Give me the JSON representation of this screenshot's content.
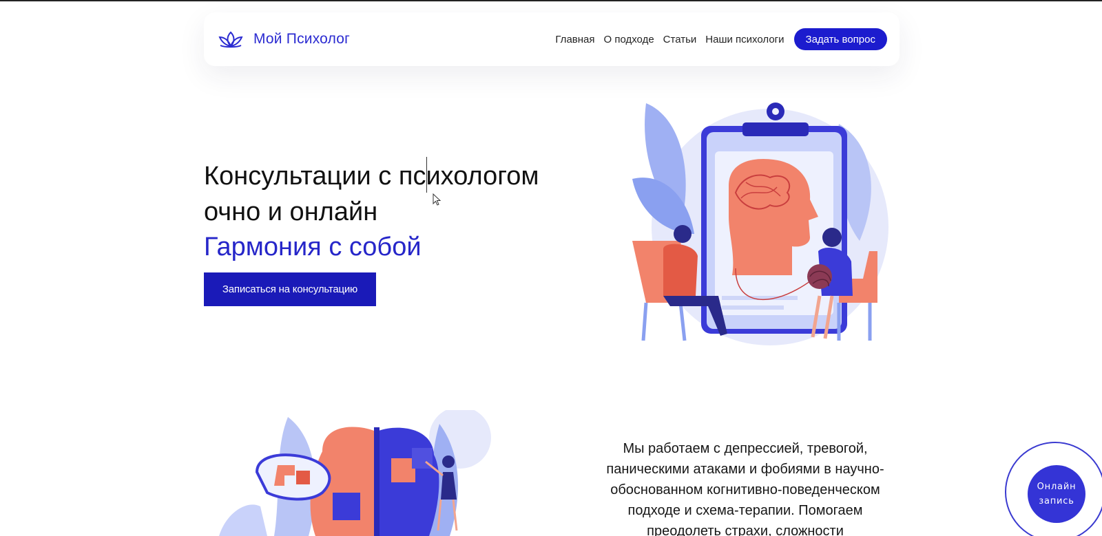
{
  "brand": {
    "name": "Мой Психолог",
    "logo": "lotus-logo-icon"
  },
  "nav": {
    "items": [
      "Главная",
      "О подходе",
      "Статьи",
      "Наши психологи"
    ],
    "ask_button": "Задать вопрос"
  },
  "hero": {
    "title_line1": "Консультации с психологом",
    "title_line2": "очно и онлайн",
    "subtitle": "Гармония с собой",
    "cta": "Записаться на консультацию"
  },
  "about": {
    "text": "Мы работаем с депрессией, тревогой, паническими атаками и фобиями в научно-обоснованном когнитивно-поведенческом подходе и схема-терапии. Помогаем преодолеть страхи, сложности"
  },
  "booking": {
    "label": "Онлайн запись"
  },
  "colors": {
    "accent": "#1c1cce",
    "accent_light": "#3434d6",
    "coral": "#f2836b",
    "lavender": "#dfe3fb"
  }
}
